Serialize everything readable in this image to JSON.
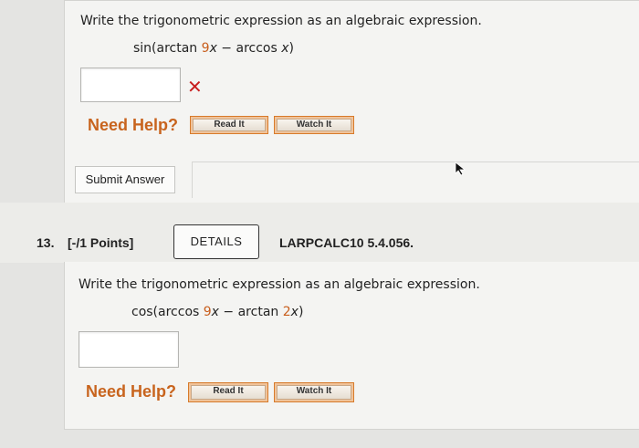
{
  "q12": {
    "prompt": "Write the trigonometric expression as an algebraic expression.",
    "expr": {
      "p1": "sin(arctan ",
      "c1": "9",
      "v1": "x",
      "p2": " − arccos ",
      "v2": "x",
      "p3": ")"
    },
    "answer_value": "",
    "wrong_mark": "✕",
    "need_help": "Need Help?",
    "read_it": "Read It",
    "watch_it": "Watch It",
    "submit": "Submit Answer"
  },
  "q13": {
    "number": "13.",
    "points": "[-/1 Points]",
    "details": "DETAILS",
    "code": "LARPCALC10 5.4.056.",
    "prompt": "Write the trigonometric expression as an algebraic expression.",
    "expr": {
      "p1": "cos(arccos ",
      "c1": "9",
      "v1": "x",
      "p2": " − arctan ",
      "c2": "2",
      "v2": "x",
      "p3": ")"
    },
    "answer_value": "",
    "need_help": "Need Help?",
    "read_it": "Read It",
    "watch_it": "Watch It"
  },
  "colors": {
    "accent_orange": "#c8641e",
    "wrong_red": "#c81e1e"
  },
  "icons": {
    "wrong": "x-mark-icon",
    "cursor": "mouse-pointer-icon"
  }
}
